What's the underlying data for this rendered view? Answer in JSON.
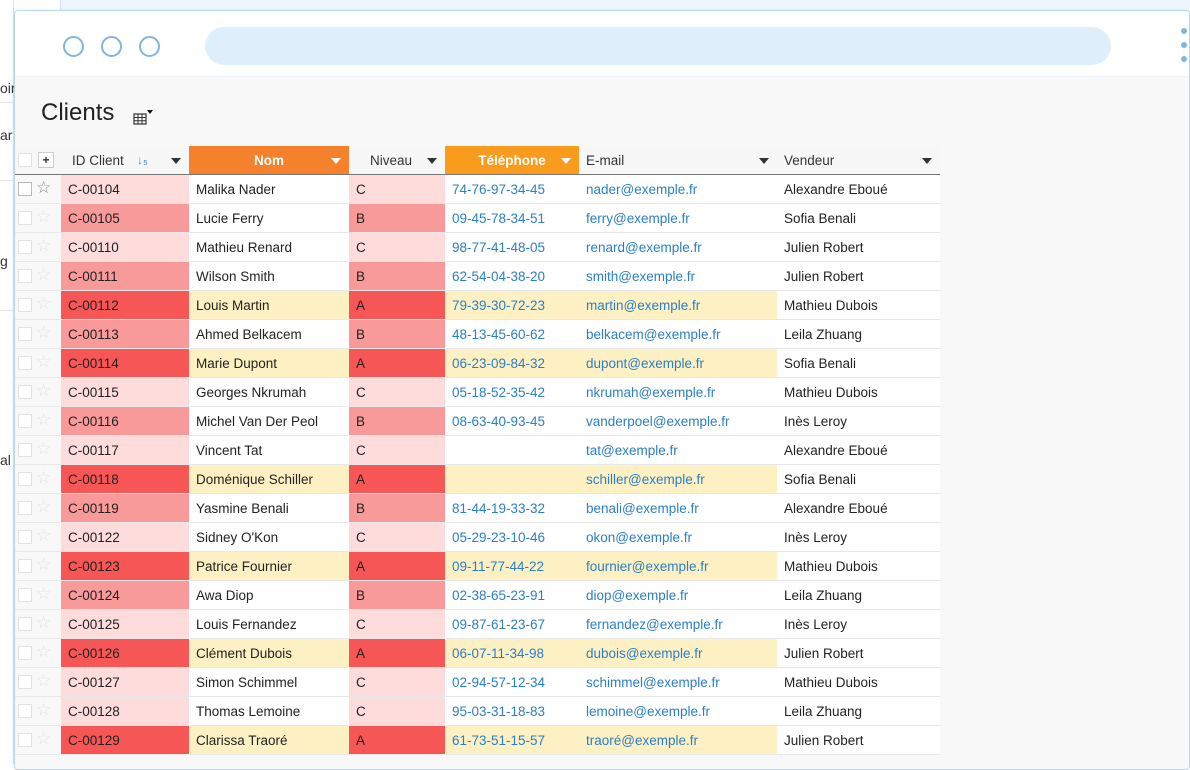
{
  "background_window": {
    "fragments": [
      "oir",
      "ar",
      "g",
      "al"
    ]
  },
  "window": {
    "dots": [
      "window-dot",
      "window-dot",
      "window-dot"
    ],
    "url": ""
  },
  "page": {
    "title": "Clients",
    "view_icon": "table-view-icon"
  },
  "table": {
    "columns": [
      {
        "label": "ID Client",
        "sort": "ascending"
      },
      {
        "label": "Nom",
        "style": "orange"
      },
      {
        "label": "Niveau"
      },
      {
        "label": "Téléphone",
        "style": "orange"
      },
      {
        "label": "E-mail"
      },
      {
        "label": "Vendeur"
      }
    ],
    "colors": {
      "level_A": "#f75656",
      "level_B": "#f99a9a",
      "level_C": "#fedcdc",
      "highlight": "#fdf1c4",
      "header_orange": "#f5812d",
      "header_orange_2": "#f99b1c",
      "link": "#2b7fc6"
    },
    "rows": [
      {
        "id": "C-00104",
        "nom": "Malika Nader",
        "niveau": "C",
        "tel": "74-76-97-34-45",
        "email": "nader@exemple.fr",
        "vendeur": "Alexandre Eboué"
      },
      {
        "id": "C-00105",
        "nom": "Lucie Ferry",
        "niveau": "B",
        "tel": "09-45-78-34-51",
        "email": "ferry@exemple.fr",
        "vendeur": "Sofia Benali"
      },
      {
        "id": "C-00110",
        "nom": "Mathieu Renard",
        "niveau": "C",
        "tel": "98-77-41-48-05",
        "email": "renard@exemple.fr",
        "vendeur": "Julien Robert"
      },
      {
        "id": "C-00111",
        "nom": "Wilson Smith",
        "niveau": "B",
        "tel": "62-54-04-38-20",
        "email": "smith@exemple.fr",
        "vendeur": "Julien Robert"
      },
      {
        "id": "C-00112",
        "nom": "Louis Martin",
        "niveau": "A",
        "tel": "79-39-30-72-23",
        "email": "martin@exemple.fr",
        "vendeur": "Mathieu Dubois"
      },
      {
        "id": "C-00113",
        "nom": "Ahmed Belkacem",
        "niveau": "B",
        "tel": "48-13-45-60-62",
        "email": "belkacem@exemple.fr",
        "vendeur": "Leila Zhuang"
      },
      {
        "id": "C-00114",
        "nom": "Marie Dupont",
        "niveau": "A",
        "tel": "06-23-09-84-32",
        "email": "dupont@exemple.fr",
        "vendeur": "Sofia Benali"
      },
      {
        "id": "C-00115",
        "nom": "Georges Nkrumah",
        "niveau": "C",
        "tel": "05-18-52-35-42",
        "email": "nkrumah@exemple.fr",
        "vendeur": "Mathieu Dubois"
      },
      {
        "id": "C-00116",
        "nom": "Michel Van Der Peol",
        "niveau": "B",
        "tel": "08-63-40-93-45",
        "email": "vanderpoel@exemple.fr",
        "vendeur": "Inès Leroy"
      },
      {
        "id": "C-00117",
        "nom": "Vincent Tat",
        "niveau": "C",
        "tel": "",
        "email": "tat@exemple.fr",
        "vendeur": "Alexandre Eboué"
      },
      {
        "id": "C-00118",
        "nom": "Doménique Schiller",
        "niveau": "A",
        "tel": "",
        "email": "schiller@exemple.fr",
        "vendeur": "Sofia Benali"
      },
      {
        "id": "C-00119",
        "nom": "Yasmine Benali",
        "niveau": "B",
        "tel": "81-44-19-33-32",
        "email": "benali@exemple.fr",
        "vendeur": "Alexandre Eboué"
      },
      {
        "id": "C-00122",
        "nom": "Sidney O'Kon",
        "niveau": "C",
        "tel": "05-29-23-10-46",
        "email": "okon@exemple.fr",
        "vendeur": "Inès Leroy"
      },
      {
        "id": "C-00123",
        "nom": "Patrice Fournier",
        "niveau": "A",
        "tel": "09-11-77-44-22",
        "email": "fournier@exemple.fr",
        "vendeur": "Mathieu Dubois"
      },
      {
        "id": "C-00124",
        "nom": "Awa Diop",
        "niveau": "B",
        "tel": "02-38-65-23-91",
        "email": "diop@exemple.fr",
        "vendeur": "Leila Zhuang"
      },
      {
        "id": "C-00125",
        "nom": "Louis Fernandez",
        "niveau": "C",
        "tel": "09-87-61-23-67",
        "email": "fernandez@exemple.fr",
        "vendeur": "Inès Leroy"
      },
      {
        "id": "C-00126",
        "nom": "Clément Dubois",
        "niveau": "A",
        "tel": "06-07-11-34-98",
        "email": "dubois@exemple.fr",
        "vendeur": "Julien Robert"
      },
      {
        "id": "C-00127",
        "nom": "Simon Schimmel",
        "niveau": "C",
        "tel": "02-94-57-12-34",
        "email": "schimmel@exemple.fr",
        "vendeur": "Mathieu Dubois"
      },
      {
        "id": "C-00128",
        "nom": "Thomas Lemoine",
        "niveau": "C",
        "tel": "95-03-31-18-83",
        "email": "lemoine@exemple.fr",
        "vendeur": "Leila Zhuang"
      },
      {
        "id": "C-00129",
        "nom": "Clarissa Traoré",
        "niveau": "A",
        "tel": "61-73-51-15-57",
        "email": "traoré@exemple.fr",
        "vendeur": "Julien Robert"
      }
    ]
  }
}
